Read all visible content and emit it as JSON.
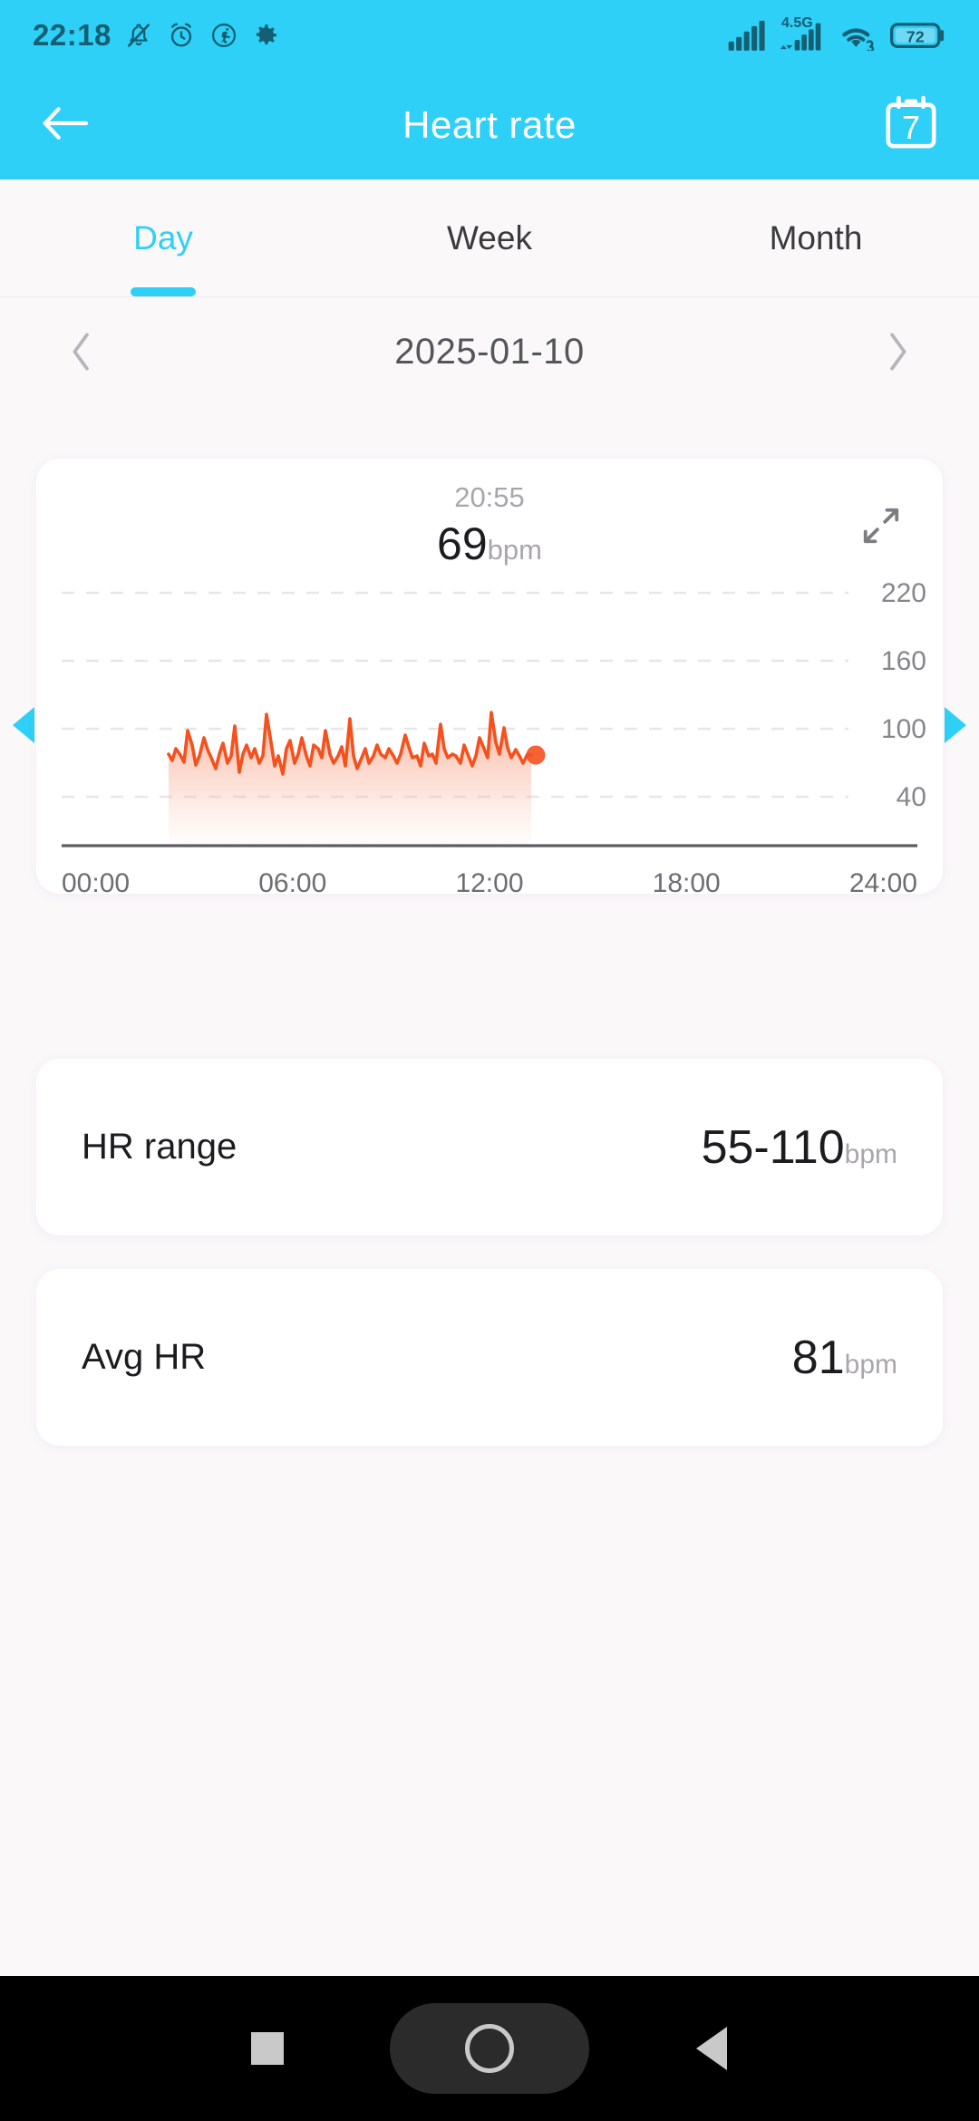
{
  "status_bar": {
    "time": "22:18",
    "network_label": "4.5G",
    "battery_level": "72",
    "icons": [
      "bell-muted-icon",
      "alarm-clock-icon",
      "activity-icon",
      "gear-icon",
      "signal-bars-icon",
      "signal-bars-icon",
      "wifi-icon",
      "battery-icon"
    ]
  },
  "header": {
    "title": "Heart rate",
    "back_icon": "arrow-left-icon",
    "calendar_icon": "calendar-icon",
    "calendar_day": "7"
  },
  "tabs": [
    {
      "label": "Day",
      "active": true
    },
    {
      "label": "Week",
      "active": false
    },
    {
      "label": "Month",
      "active": false
    }
  ],
  "date_nav": {
    "date": "2025-01-10",
    "prev_icon": "chevron-left-icon",
    "next_icon": "chevron-right-icon"
  },
  "pager": {
    "left_icon": "triangle-left-icon",
    "right_icon": "triangle-right-icon"
  },
  "chart_card": {
    "selected_time": "20:55",
    "selected_value": "69",
    "unit": "bpm",
    "expand_icon": "expand-icon"
  },
  "stats": [
    {
      "label": "HR range",
      "value": "55-110",
      "unit": "bpm"
    },
    {
      "label": "Avg HR",
      "value": "81",
      "unit": "bpm"
    }
  ],
  "nav_bar": {
    "recents_icon": "square-icon",
    "home_icon": "circle-icon",
    "back_icon": "triangle-back-icon"
  },
  "colors": {
    "accent": "#2ED0F7",
    "line": "#F4511E",
    "fill_top": "#F8A48C",
    "page_bg": "#FBF8FA",
    "card_bg": "#FFFFFF"
  },
  "chart_data": {
    "type": "area",
    "title": "Heart rate",
    "xlabel": "",
    "ylabel": "bpm",
    "xticks": [
      "00:00",
      "06:00",
      "12:00",
      "18:00",
      "24:00"
    ],
    "yticks": [
      220,
      160,
      100,
      40
    ],
    "ylim": [
      10,
      250
    ],
    "xlim": [
      0,
      24
    ],
    "grid": "horizontal-dashed",
    "legend": "none",
    "selected_point": {
      "x": "20:55",
      "y": 69
    },
    "series": [
      {
        "name": "Heart rate",
        "color": "#F4511E",
        "x": [
          2.5,
          2.7,
          2.9,
          3.1,
          3.3,
          3.5,
          3.7,
          3.9,
          4.1,
          4.3,
          4.5,
          4.7,
          4.9,
          5.1,
          5.3,
          5.5,
          5.7,
          5.9,
          6.1,
          6.3,
          6.5,
          6.7,
          6.9,
          7.1,
          7.3,
          7.5,
          7.7,
          7.9,
          8.1,
          8.3,
          8.5,
          8.7,
          8.9,
          9.1,
          9.3,
          9.5,
          9.7,
          9.9,
          10.1,
          10.3,
          10.5,
          10.7,
          10.9,
          11.1,
          11.3,
          11.5,
          11.7,
          11.9,
          12.1,
          12.3,
          12.5,
          12.7,
          12.9,
          13.1,
          13.3,
          13.5,
          13.7,
          13.9,
          14.1,
          14.3,
          14.5,
          14.7,
          14.9,
          15.1,
          15.3,
          15.5,
          15.7,
          15.9,
          16.1,
          16.3,
          16.5,
          16.7,
          16.9,
          17.1,
          17.3,
          17.5,
          17.7,
          17.9,
          18.1,
          18.3,
          18.5,
          18.7,
          18.9,
          19.1,
          19.3,
          19.5,
          19.7,
          19.9,
          20.1,
          20.3,
          20.5,
          20.7,
          20.9
        ],
        "y": [
          72,
          68,
          74,
          70,
          66,
          92,
          78,
          64,
          70,
          86,
          74,
          68,
          62,
          72,
          80,
          66,
          70,
          96,
          60,
          72,
          78,
          68,
          74,
          66,
          70,
          108,
          76,
          64,
          70,
          58,
          74,
          80,
          66,
          72,
          86,
          70,
          64,
          78,
          74,
          68,
          92,
          72,
          66,
          70,
          76,
          64,
          104,
          70,
          62,
          68,
          74,
          66,
          70,
          78,
          72,
          68,
          74,
          70,
          66,
          72,
          88,
          74,
          68,
          70,
          64,
          76,
          70,
          72,
          66,
          98,
          74,
          68,
          72,
          70,
          66,
          78,
          72,
          64,
          70,
          86,
          74,
          68,
          110,
          80,
          72,
          94,
          76,
          68,
          74,
          70,
          66,
          72,
          69
        ]
      }
    ]
  }
}
